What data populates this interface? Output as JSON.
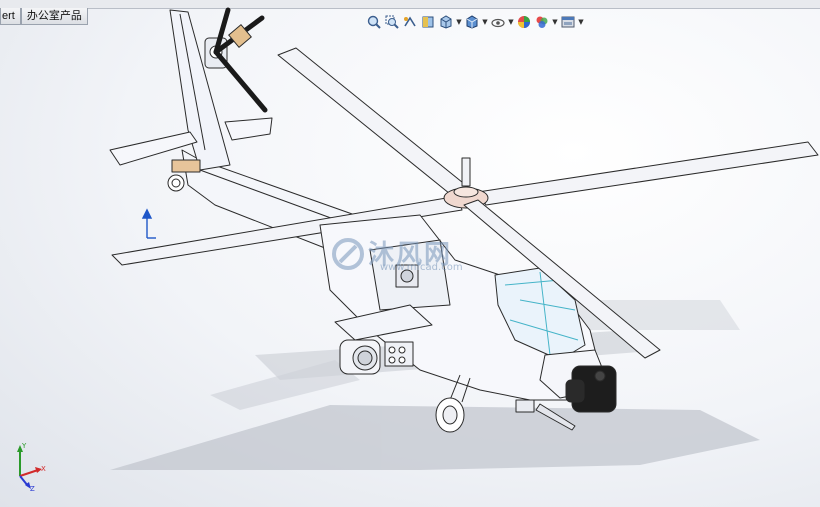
{
  "tabs": [
    {
      "label": "ert"
    },
    {
      "label": "办公室产品"
    }
  ],
  "hud_toolbar": [
    {
      "icon": "zoom-to-fit-icon"
    },
    {
      "icon": "zoom-to-area-icon"
    },
    {
      "icon": "previous-view-icon"
    },
    {
      "icon": "section-view-icon"
    },
    {
      "icon": "view-orientation-icon"
    },
    {
      "icon": "display-style-icon"
    },
    {
      "icon": "hide-show-items-icon"
    },
    {
      "icon": "edit-appearance-icon"
    },
    {
      "icon": "apply-scene-icon"
    },
    {
      "icon": "view-settings-icon"
    }
  ],
  "watermark": {
    "text": "沐风网",
    "url": "www.mfcad.com"
  },
  "triad": {
    "x": "X",
    "y": "Y",
    "z": "Z"
  },
  "colors": {
    "accent_blue": "#1f57c8",
    "axis_x": "#d22a2a",
    "axis_y": "#2a9a2a",
    "axis_z": "#2a3ad2",
    "model_fill": "#ffffff",
    "model_stroke": "#2b2b2b",
    "shadow": "#c4c8d0"
  }
}
